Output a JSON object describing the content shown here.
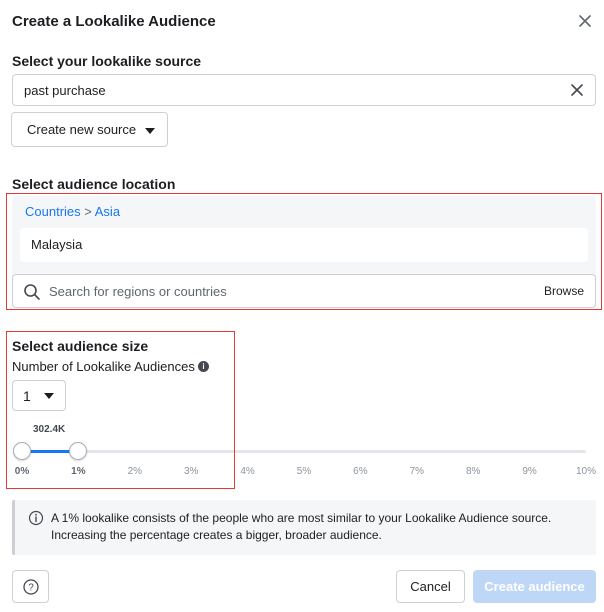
{
  "dialog": {
    "title": "Create a Lookalike Audience"
  },
  "source": {
    "heading": "Select your lookalike source",
    "value": "past purchase",
    "create_button": "Create new source"
  },
  "location": {
    "heading": "Select audience location",
    "breadcrumb_root": "Countries",
    "breadcrumb_sep": ">",
    "breadcrumb_leaf": "Asia",
    "selected": "Malaysia",
    "search_placeholder": "Search for regions or countries",
    "browse_label": "Browse"
  },
  "size": {
    "heading": "Select audience size",
    "count_label": "Number of Lookalike Audiences",
    "count_value": "1",
    "slider_value_label": "302.4K",
    "slider_range_pct": [
      0,
      1
    ],
    "ticks": [
      "0%",
      "1%",
      "2%",
      "3%",
      "4%",
      "5%",
      "6%",
      "7%",
      "8%",
      "9%",
      "10%"
    ],
    "active_ticks": [
      "0%",
      "1%"
    ]
  },
  "info": {
    "text": "A 1% lookalike consists of the people who are most similar to your Lookalike Audience source. Increasing the percentage creates a bigger, broader audience."
  },
  "footer": {
    "help_label": "?",
    "cancel_label": "Cancel",
    "create_label": "Create audience"
  },
  "colors": {
    "accent": "#1877f2",
    "highlight_border": "#e53935",
    "disabled_button": "#bed7f7"
  },
  "icons": {
    "close": "close-icon",
    "clear": "clear-icon",
    "search": "search-icon",
    "info": "info-icon",
    "help": "help-icon",
    "dropdown": "chevron-down-icon"
  }
}
